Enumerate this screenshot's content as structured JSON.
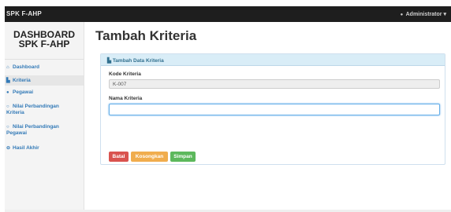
{
  "topbar": {
    "brand": "SPK F-AHP",
    "user_icon": "user-icon",
    "user_label": "Administrator",
    "user_caret": "▾"
  },
  "sidebar": {
    "title_line1": "DASHBOARD",
    "title_line2": "SPK F-AHP",
    "items": [
      {
        "icon": "home-icon",
        "glyph": "⌂",
        "label": "Dashboard"
      },
      {
        "icon": "document-icon",
        "glyph": "▙",
        "label": "Kriteria"
      },
      {
        "icon": "user-icon",
        "glyph": "●",
        "label": "Pegawai"
      },
      {
        "icon": "search-icon",
        "glyph": "○",
        "label_line1": "Nilai Perbandingan",
        "label_line2": "Kriteria"
      },
      {
        "icon": "search-icon",
        "glyph": "○",
        "label_line1": "Nilai Perbandingan",
        "label_line2": "Pegawai"
      },
      {
        "icon": "minus-circle-icon",
        "glyph": "⊖",
        "label": "Hasil Akhir"
      }
    ]
  },
  "main": {
    "title": "Tambah Kriteria",
    "panel": {
      "heading_icon": "document-icon",
      "heading": "Tambah Data Kriteria",
      "code_label": "Kode Kriteria",
      "code_value": "K-007",
      "name_label": "Nama Kriteria",
      "name_value": "",
      "buttons": {
        "cancel": "Batal",
        "clear": "Kosongkan",
        "save": "Simpan"
      }
    }
  },
  "colors": {
    "topbar": "#1e1e1e",
    "link": "#337ab7",
    "panel_head": "#d9edf7",
    "danger": "#d9534f",
    "warning": "#f0ad4e",
    "success": "#5cb85c"
  }
}
